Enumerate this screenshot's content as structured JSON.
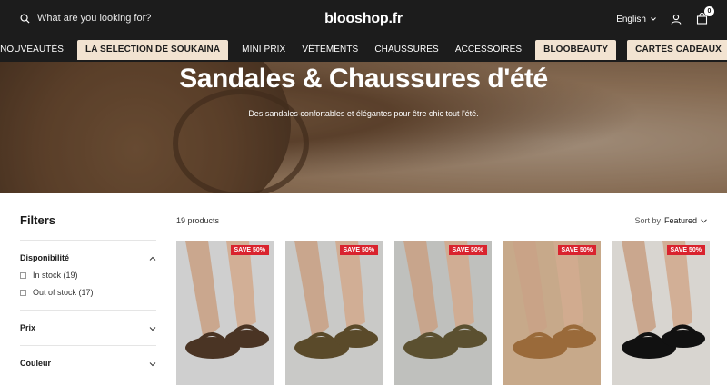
{
  "header": {
    "search_placeholder": "What are you looking for?",
    "logo": "blooshop.fr",
    "language": "English",
    "cart_count": "0"
  },
  "nav": {
    "items": [
      {
        "label": "NOUVEAUTÉS",
        "highlight": false
      },
      {
        "label": "LA SELECTION DE SOUKAINA",
        "highlight": true
      },
      {
        "label": "MINI PRIX",
        "highlight": false
      },
      {
        "label": "VÊTEMENTS",
        "highlight": false
      },
      {
        "label": "CHAUSSURES",
        "highlight": false
      },
      {
        "label": "ACCESSOIRES",
        "highlight": false
      },
      {
        "label": "BLOOBEAUTY",
        "highlight": true
      },
      {
        "label": "CARTES CADEAUX",
        "highlight": true
      }
    ]
  },
  "hero": {
    "title": "Sandales & Chaussures d'été",
    "subtitle": "Des sandales confortables et élégantes pour être chic tout l'été."
  },
  "filters": {
    "title": "Filters",
    "availability": {
      "title": "Disponibilité",
      "options": [
        {
          "label": "In stock (19)"
        },
        {
          "label": "Out of stock (17)"
        }
      ]
    },
    "price": {
      "title": "Prix"
    },
    "color": {
      "title": "Couleur"
    }
  },
  "toolbar": {
    "count": "19 products",
    "sort_label": "Sort by",
    "sort_value": "Featured"
  },
  "products": [
    {
      "badge": "SAVE 50%",
      "bg": "#cfcfcf",
      "shoe": "#4a3424"
    },
    {
      "badge": "SAVE 50%",
      "bg": "#c9c9c7",
      "shoe": "#5a4a2a"
    },
    {
      "badge": "SAVE 50%",
      "bg": "#bfc0bd",
      "shoe": "#5b5030"
    },
    {
      "badge": "SAVE 50%",
      "bg": "#c7a98a",
      "shoe": "#9a6a3a"
    },
    {
      "badge": "SAVE 50%",
      "bg": "#d8d5d0",
      "shoe": "#111111"
    }
  ],
  "colors": {
    "topbar": "#1c1c1c",
    "accent_tab": "#f2e3d1",
    "sale_badge": "#d9232e"
  }
}
